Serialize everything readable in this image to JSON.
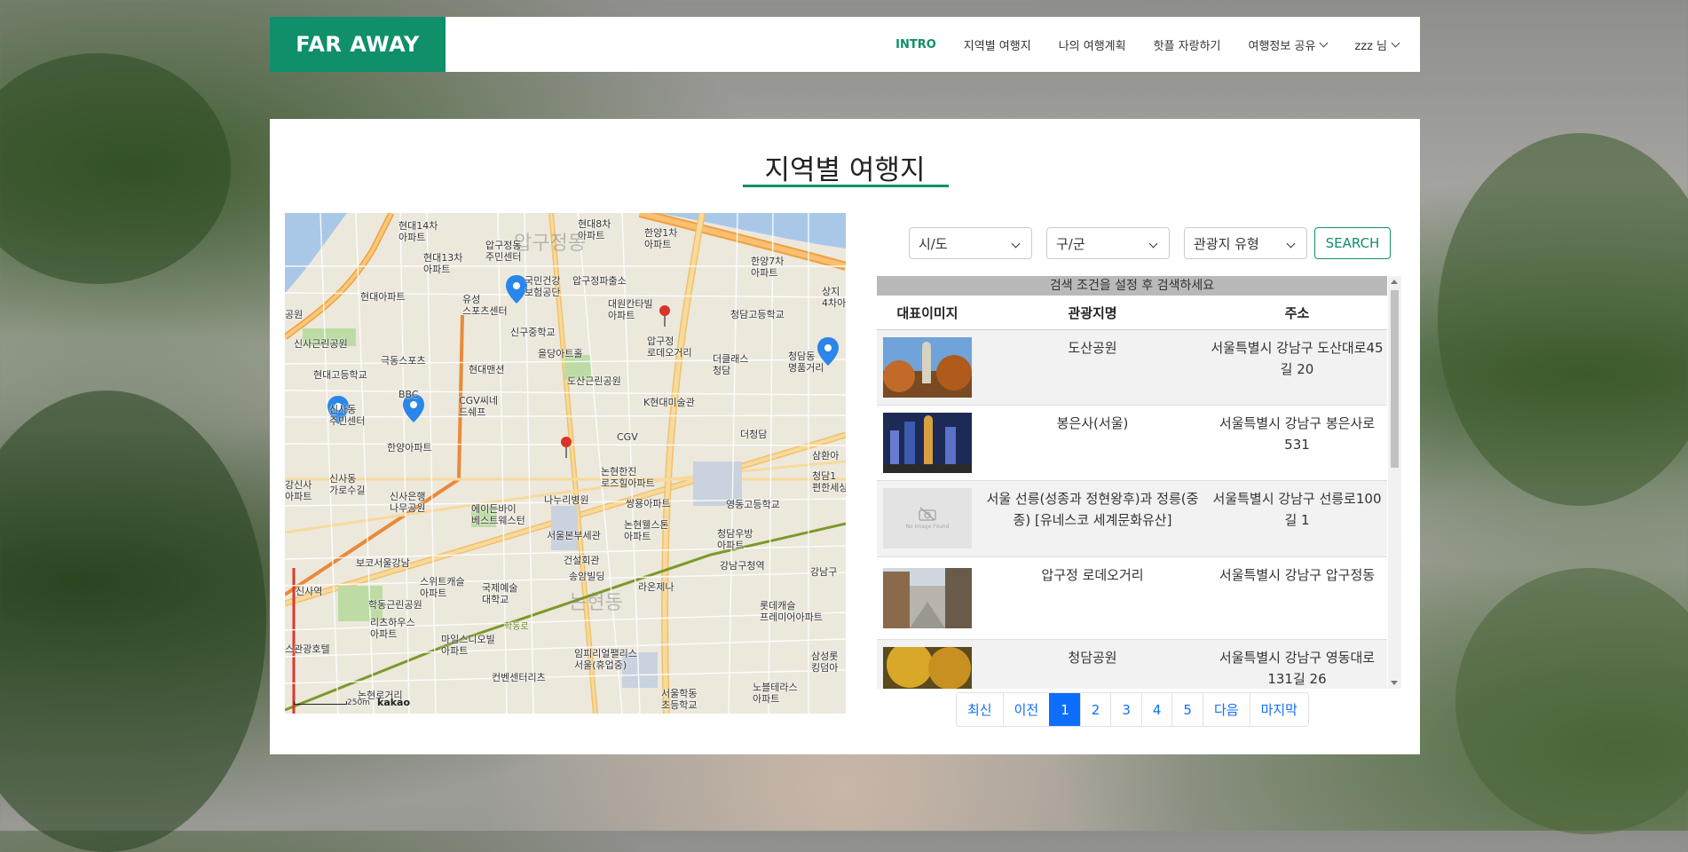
{
  "header": {
    "logo": "FAR AWAY",
    "nav": [
      {
        "label": "INTRO",
        "active": true,
        "dropdown": false
      },
      {
        "label": "지역별 여행지",
        "active": false,
        "dropdown": false
      },
      {
        "label": "나의 여행계획",
        "active": false,
        "dropdown": false
      },
      {
        "label": "핫플 자랑하기",
        "active": false,
        "dropdown": false
      },
      {
        "label": "여행정보 공유",
        "active": false,
        "dropdown": true
      },
      {
        "label": "zzz 님",
        "active": false,
        "dropdown": true
      }
    ]
  },
  "page": {
    "title": "지역별 여행지"
  },
  "map": {
    "labels": {
      "l1": "현대14차\n아파트",
      "l2": "현대13차\n아파트",
      "l3": "압구정동\n주민센터",
      "l4": "현대8차\n아파트",
      "l5": "한양1차\n아파트",
      "l6": "한양7차\n아파트",
      "l7": "압구정동",
      "l8": "현대아파트",
      "l9": "국민건강\n보험공단",
      "l10": "유성\n스포츠센터",
      "l11": "압구정파출소",
      "l12": "대원칸타빌\n아파트",
      "l13": "청담고등학교",
      "l14": "신사근린공원",
      "l15": "극동스포츠",
      "l16": "신구중학교",
      "l17": "현대고등학교",
      "l18": "현대맨션",
      "l19": "을당아트홀",
      "l20": "압구정\n로데오거리",
      "l21": "더클래스\n청담",
      "l22": "청담동\n명품거리",
      "l23": "BBC",
      "l24": "신사동\n주민센터",
      "l25": "CGV씨네\n드쉐프",
      "l26": "도산근린공원",
      "l27": "K현대미술관",
      "l28": "한양아파트",
      "l29": "CGV",
      "l30": "더청담",
      "l31": "논현한진\n로즈힐아파트",
      "l32": "신사동\n가로수길",
      "l33": "신사은행\n나무공원",
      "l34": "나누리병원",
      "l35": "쌍용아파트",
      "l36": "영동고등학교",
      "l37": "에이든바이\n베스트웨스턴",
      "l38": "서울본부세관",
      "l39": "논현웰스톤\n아파트",
      "l40": "청담우방\n아파트",
      "l41": "건설회관",
      "l42": "송암빌딩",
      "l43": "보코서울강남",
      "l44": "스위트캐슬\n아파트",
      "l45": "국제예술\n대학교",
      "l46": "라온제나",
      "l47": "강남구청역",
      "l48": "강남구",
      "l49": "신사역",
      "l50": "학동근린공원",
      "l51": "리츠하우스\n아파트",
      "l52": "논현동",
      "l53": "롯데캐슬\n프레미어아파트",
      "l54": "마일스디오빌\n아파트",
      "l55": "임피리얼팰리스\n서울(휴업중)",
      "l56": "스관광호텔",
      "l57": "컨벤센터리츠",
      "l58": "서울학동\n초등학교",
      "l59": "노블테라스\n아파트",
      "l60": "삼성롯\n킹덤아",
      "l61": "논현로거리",
      "l62": "삼환아",
      "l63": "청담1\n편한세상",
      "l64": "강신사\n아파트",
      "l65": "공원",
      "l66": "상지\n4차아",
      "l67": "학동로"
    },
    "scale": "250m",
    "provider": "kakao"
  },
  "filters": {
    "sido": "시/도",
    "gugun": "구/군",
    "type": "관광지 유형",
    "search": "SEARCH"
  },
  "table": {
    "caption": "검색 조건을 설정 후 검색하세요",
    "headers": {
      "image": "대표이미지",
      "name": "관광지명",
      "address": "주소"
    },
    "rows": [
      {
        "name": "도산공원",
        "address": "서울특별시 강남구 도산대로45길 20",
        "thumb": "park-statue"
      },
      {
        "name": "봉은사(서울)",
        "address": "서울특별시 강남구 봉은사로 531",
        "thumb": "temple-night"
      },
      {
        "name": "서울 선릉(성종과 정현왕후)과 정릉(중종) [유네스코 세계문화유산]",
        "address": "서울특별시 강남구 선릉로100길 1",
        "thumb": "no-image",
        "no_image_text": "No Image Found"
      },
      {
        "name": "압구정 로데오거리",
        "address": "서울특별시 강남구 압구정동",
        "thumb": "street"
      },
      {
        "name": "청담공원",
        "address": "서울특별시 강남구 영동대로131길 26",
        "thumb": "autumn-park"
      }
    ]
  },
  "pagination": [
    "최신",
    "이전",
    "1",
    "2",
    "3",
    "4",
    "5",
    "다음",
    "마지막"
  ],
  "pagination_active": "1",
  "colors": {
    "brand": "#0f8f6a",
    "page_active": "#0d6efd"
  }
}
